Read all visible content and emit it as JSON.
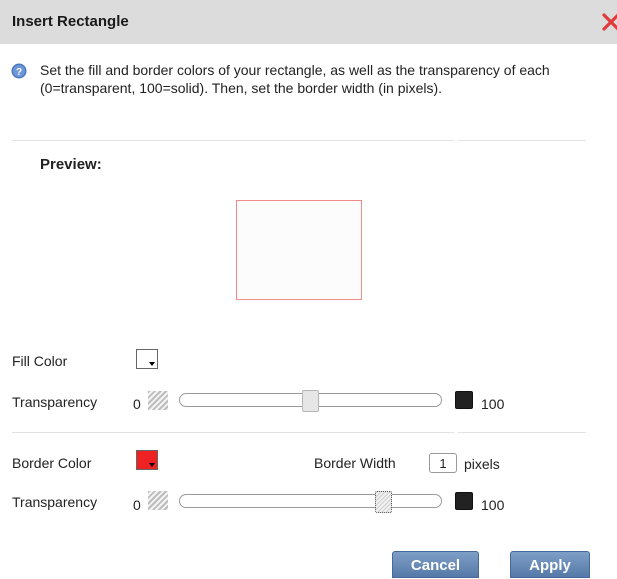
{
  "dialog": {
    "title": "Insert Rectangle",
    "instructions": "Set the fill and border colors of your rectangle, as well as the transparency of each (0=transparent, 100=solid). Then, set the border width (in pixels)."
  },
  "preview": {
    "label": "Preview:",
    "border_color": "#f28a8a"
  },
  "fill": {
    "color_label": "Fill Color",
    "color": "#ffffff",
    "transparency_label": "Transparency",
    "min_label": "0",
    "max_label": "100",
    "transparency_value": 50
  },
  "border": {
    "color_label": "Border Color",
    "color": "#ee2222",
    "width_label": "Border Width",
    "width_value": "1",
    "width_unit": "pixels",
    "transparency_label": "Transparency",
    "min_label": "0",
    "max_label": "100",
    "transparency_value": 80
  },
  "buttons": {
    "cancel": "Cancel",
    "apply": "Apply"
  },
  "icons": {
    "info": "info-icon",
    "close": "close-icon"
  }
}
